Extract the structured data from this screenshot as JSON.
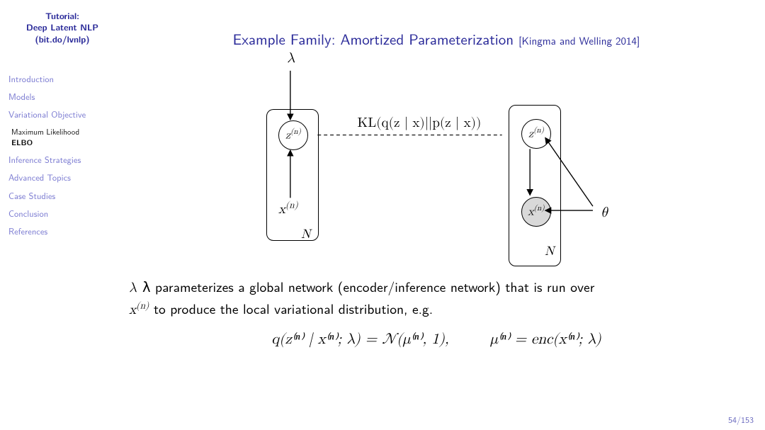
{
  "sidebar": {
    "title_l1": "Tutorial:",
    "title_l2": "Deep Latent NLP",
    "title_l3": "(bit.do/lvnlp)",
    "items": [
      "Introduction",
      "Models",
      "Variational Objective",
      "Inference Strategies",
      "Advanced Topics",
      "Case Studies",
      "Conclusion",
      "References"
    ],
    "subitems": {
      "ml": "Maximum Likelihood",
      "elbo": "ELBO"
    }
  },
  "slide": {
    "title_main": "Example Family: Amortized Parameterization",
    "title_cite": "[Kingma and Welling 2014]",
    "lambda": "λ",
    "theta": "θ",
    "kl": "KL(q(z | x)||p(z | x))",
    "z_sup": "z",
    "x_sup": "x",
    "sup_n": "(n)",
    "N": "N",
    "para_1a": "λ parameterizes a global network (encoder/inference network) that is run over",
    "para_1b_pre": "x",
    "para_1b_sup": "(n)",
    "para_1b_post": " to produce the local variational distribution, e.g.",
    "eq_left": "q(z⁽ⁿ⁾ | x⁽ⁿ⁾; λ) = 𝒩(μ⁽ⁿ⁾, 1),",
    "eq_right": "μ⁽ⁿ⁾ = enc(x⁽ⁿ⁾; λ)",
    "page": "54/153"
  }
}
